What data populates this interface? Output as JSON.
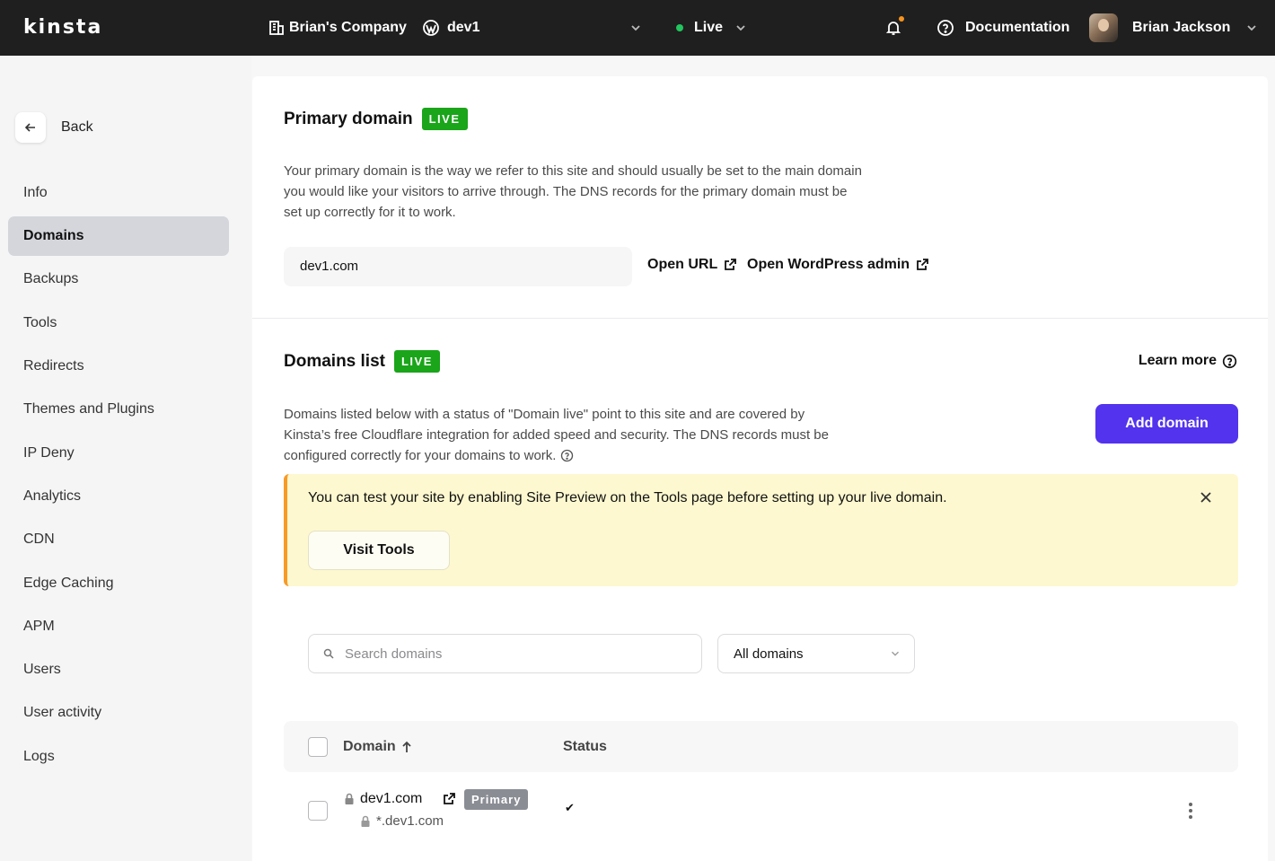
{
  "topbar": {
    "logo": "kinsta",
    "company": "Brian's Company",
    "site": "dev1",
    "environment": "Live",
    "documentation": "Documentation",
    "user_name": "Brian Jackson"
  },
  "sidebar": {
    "back_label": "Back",
    "items": [
      {
        "label": "Info",
        "active": false
      },
      {
        "label": "Domains",
        "active": true
      },
      {
        "label": "Backups",
        "active": false
      },
      {
        "label": "Tools",
        "active": false
      },
      {
        "label": "Redirects",
        "active": false
      },
      {
        "label": "Themes and Plugins",
        "active": false
      },
      {
        "label": "IP Deny",
        "active": false
      },
      {
        "label": "Analytics",
        "active": false
      },
      {
        "label": "CDN",
        "active": false
      },
      {
        "label": "Edge Caching",
        "active": false
      },
      {
        "label": "APM",
        "active": false
      },
      {
        "label": "Users",
        "active": false
      },
      {
        "label": "User activity",
        "active": false
      },
      {
        "label": "Logs",
        "active": false
      }
    ]
  },
  "primary_domain": {
    "title": "Primary domain",
    "badge": "LIVE",
    "description_lines": [
      "Your primary domain is the way we refer to this site and should usually be set to the main domain",
      "you would like your visitors to arrive through. The DNS records for the primary domain must be",
      "set up correctly for it to work."
    ],
    "value": "dev1.com",
    "open_url": "Open URL",
    "open_wp_admin": "Open WordPress admin"
  },
  "domains_list": {
    "title": "Domains list",
    "badge": "LIVE",
    "learn_more": "Learn more",
    "description_lines": [
      "Domains listed below with a status of \"Domain live\" point to this site and are covered by",
      "Kinsta’s free Cloudflare integration for added speed and security. The DNS records must be",
      "configured correctly for your domains to work."
    ],
    "add_domain": "Add domain",
    "notice": {
      "text": "You can test your site by enabling Site Preview on the Tools page before setting up your live domain.",
      "button": "Visit Tools"
    },
    "search_placeholder": "Search domains",
    "filter_selected": "All domains",
    "columns": [
      "Domain",
      "Status"
    ],
    "rows": [
      {
        "domain": "dev1.com",
        "wildcard": "*.dev1.com",
        "tag": "Primary",
        "status": "✔"
      }
    ]
  },
  "colors": {
    "topbar": "#1f1f1f",
    "live_badge": "#1aa51a",
    "primary_button": "#5333ed",
    "notice_bg": "#fdf8cf",
    "notice_accent": "#f79a26"
  }
}
